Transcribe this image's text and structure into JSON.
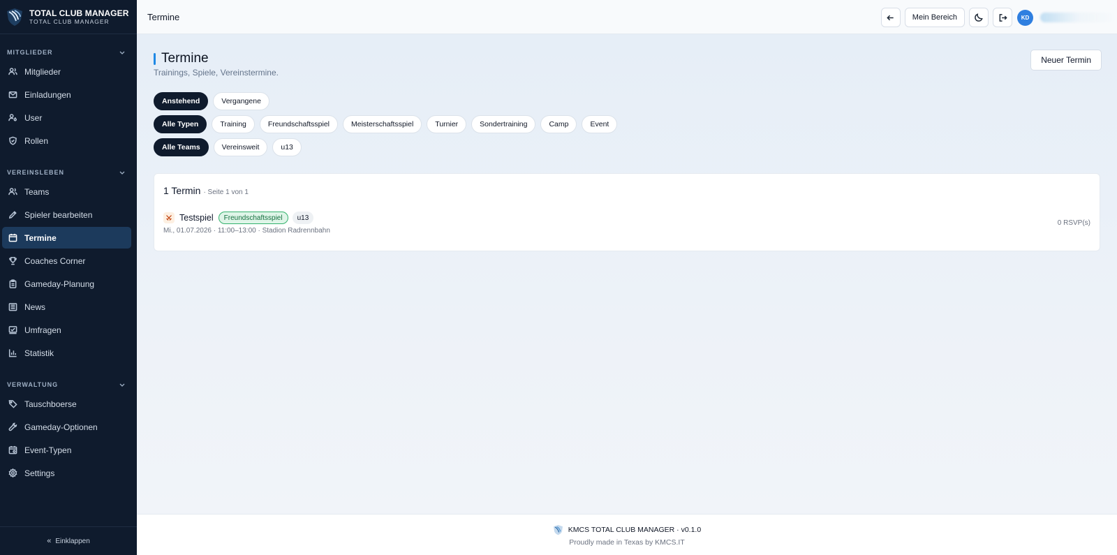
{
  "app": {
    "brand_title": "TOTAL CLUB MANAGER",
    "brand_subtitle": "TOTAL CLUB MANAGER"
  },
  "sidebar": {
    "sections": [
      {
        "title": "MITGLIEDER",
        "items": [
          {
            "label": "Mitglieder",
            "icon": "users-icon"
          },
          {
            "label": "Einladungen",
            "icon": "mail-icon"
          },
          {
            "label": "User",
            "icon": "user-key-icon"
          },
          {
            "label": "Rollen",
            "icon": "shield-icon"
          }
        ]
      },
      {
        "title": "VEREINSLEBEN",
        "items": [
          {
            "label": "Teams",
            "icon": "users-icon"
          },
          {
            "label": "Spieler bearbeiten",
            "icon": "pencil-icon"
          },
          {
            "label": "Termine",
            "icon": "calendar-icon",
            "active": true
          },
          {
            "label": "Coaches Corner",
            "icon": "trophy-icon"
          },
          {
            "label": "Gameday-Planung",
            "icon": "clipboard-icon"
          },
          {
            "label": "News",
            "icon": "newspaper-icon"
          },
          {
            "label": "Umfragen",
            "icon": "poll-icon"
          },
          {
            "label": "Statistik",
            "icon": "bar-chart-icon"
          }
        ]
      },
      {
        "title": "VERWALTUNG",
        "items": [
          {
            "label": "Tauschboerse",
            "icon": "tag-icon"
          },
          {
            "label": "Gameday-Optionen",
            "icon": "wrench-icon"
          },
          {
            "label": "Event-Typen",
            "icon": "calendar-settings-icon"
          },
          {
            "label": "Settings",
            "icon": "gear-icon"
          }
        ]
      }
    ],
    "collapse_label": "Einklappen"
  },
  "topbar": {
    "title": "Termine",
    "mein_bereich": "Mein Bereich",
    "avatar_initials": "KD"
  },
  "main": {
    "title": "Termine",
    "subtitle": "Trainings, Spiele, Vereinstermine.",
    "new_button": "Neuer Termin",
    "filters": {
      "time": [
        {
          "label": "Anstehend",
          "active": true
        },
        {
          "label": "Vergangene",
          "active": false
        }
      ],
      "types": [
        {
          "label": "Alle Typen",
          "active": true
        },
        {
          "label": "Training",
          "active": false
        },
        {
          "label": "Freundschaftsspiel",
          "active": false
        },
        {
          "label": "Meisterschaftsspiel",
          "active": false
        },
        {
          "label": "Turnier",
          "active": false
        },
        {
          "label": "Sondertraining",
          "active": false
        },
        {
          "label": "Camp",
          "active": false
        },
        {
          "label": "Event",
          "active": false
        }
      ],
      "teams": [
        {
          "label": "Alle Teams",
          "active": true
        },
        {
          "label": "Vereinsweit",
          "active": false
        },
        {
          "label": "u13",
          "active": false
        }
      ]
    },
    "list": {
      "count_label": "1 Termin",
      "page_label": "· Seite 1 von 1",
      "events": [
        {
          "title": "Testspiel",
          "type": "Freundschaftsspiel",
          "team": "u13",
          "meta": "Mi., 01.07.2026 · 11:00–13:00 · Stadion Radrennbahn",
          "rsvp": "0 RSVP(s)"
        }
      ]
    }
  },
  "footer": {
    "line1": "KMCS TOTAL CLUB MANAGER · v0.1.0",
    "line2": "Proudly made in Texas by KMCS.IT"
  }
}
